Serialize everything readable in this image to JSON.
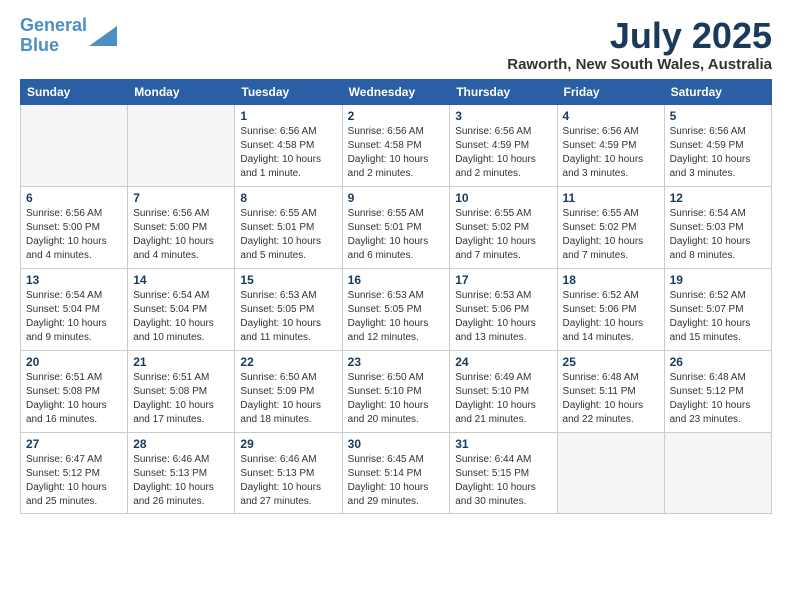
{
  "logo": {
    "line1": "General",
    "line2": "Blue"
  },
  "title": "July 2025",
  "location": "Raworth, New South Wales, Australia",
  "days_of_week": [
    "Sunday",
    "Monday",
    "Tuesday",
    "Wednesday",
    "Thursday",
    "Friday",
    "Saturday"
  ],
  "weeks": [
    [
      {
        "day": "",
        "info": ""
      },
      {
        "day": "",
        "info": ""
      },
      {
        "day": "1",
        "info": "Sunrise: 6:56 AM\nSunset: 4:58 PM\nDaylight: 10 hours and 1 minute."
      },
      {
        "day": "2",
        "info": "Sunrise: 6:56 AM\nSunset: 4:58 PM\nDaylight: 10 hours and 2 minutes."
      },
      {
        "day": "3",
        "info": "Sunrise: 6:56 AM\nSunset: 4:59 PM\nDaylight: 10 hours and 2 minutes."
      },
      {
        "day": "4",
        "info": "Sunrise: 6:56 AM\nSunset: 4:59 PM\nDaylight: 10 hours and 3 minutes."
      },
      {
        "day": "5",
        "info": "Sunrise: 6:56 AM\nSunset: 4:59 PM\nDaylight: 10 hours and 3 minutes."
      }
    ],
    [
      {
        "day": "6",
        "info": "Sunrise: 6:56 AM\nSunset: 5:00 PM\nDaylight: 10 hours and 4 minutes."
      },
      {
        "day": "7",
        "info": "Sunrise: 6:56 AM\nSunset: 5:00 PM\nDaylight: 10 hours and 4 minutes."
      },
      {
        "day": "8",
        "info": "Sunrise: 6:55 AM\nSunset: 5:01 PM\nDaylight: 10 hours and 5 minutes."
      },
      {
        "day": "9",
        "info": "Sunrise: 6:55 AM\nSunset: 5:01 PM\nDaylight: 10 hours and 6 minutes."
      },
      {
        "day": "10",
        "info": "Sunrise: 6:55 AM\nSunset: 5:02 PM\nDaylight: 10 hours and 7 minutes."
      },
      {
        "day": "11",
        "info": "Sunrise: 6:55 AM\nSunset: 5:02 PM\nDaylight: 10 hours and 7 minutes."
      },
      {
        "day": "12",
        "info": "Sunrise: 6:54 AM\nSunset: 5:03 PM\nDaylight: 10 hours and 8 minutes."
      }
    ],
    [
      {
        "day": "13",
        "info": "Sunrise: 6:54 AM\nSunset: 5:04 PM\nDaylight: 10 hours and 9 minutes."
      },
      {
        "day": "14",
        "info": "Sunrise: 6:54 AM\nSunset: 5:04 PM\nDaylight: 10 hours and 10 minutes."
      },
      {
        "day": "15",
        "info": "Sunrise: 6:53 AM\nSunset: 5:05 PM\nDaylight: 10 hours and 11 minutes."
      },
      {
        "day": "16",
        "info": "Sunrise: 6:53 AM\nSunset: 5:05 PM\nDaylight: 10 hours and 12 minutes."
      },
      {
        "day": "17",
        "info": "Sunrise: 6:53 AM\nSunset: 5:06 PM\nDaylight: 10 hours and 13 minutes."
      },
      {
        "day": "18",
        "info": "Sunrise: 6:52 AM\nSunset: 5:06 PM\nDaylight: 10 hours and 14 minutes."
      },
      {
        "day": "19",
        "info": "Sunrise: 6:52 AM\nSunset: 5:07 PM\nDaylight: 10 hours and 15 minutes."
      }
    ],
    [
      {
        "day": "20",
        "info": "Sunrise: 6:51 AM\nSunset: 5:08 PM\nDaylight: 10 hours and 16 minutes."
      },
      {
        "day": "21",
        "info": "Sunrise: 6:51 AM\nSunset: 5:08 PM\nDaylight: 10 hours and 17 minutes."
      },
      {
        "day": "22",
        "info": "Sunrise: 6:50 AM\nSunset: 5:09 PM\nDaylight: 10 hours and 18 minutes."
      },
      {
        "day": "23",
        "info": "Sunrise: 6:50 AM\nSunset: 5:10 PM\nDaylight: 10 hours and 20 minutes."
      },
      {
        "day": "24",
        "info": "Sunrise: 6:49 AM\nSunset: 5:10 PM\nDaylight: 10 hours and 21 minutes."
      },
      {
        "day": "25",
        "info": "Sunrise: 6:48 AM\nSunset: 5:11 PM\nDaylight: 10 hours and 22 minutes."
      },
      {
        "day": "26",
        "info": "Sunrise: 6:48 AM\nSunset: 5:12 PM\nDaylight: 10 hours and 23 minutes."
      }
    ],
    [
      {
        "day": "27",
        "info": "Sunrise: 6:47 AM\nSunset: 5:12 PM\nDaylight: 10 hours and 25 minutes."
      },
      {
        "day": "28",
        "info": "Sunrise: 6:46 AM\nSunset: 5:13 PM\nDaylight: 10 hours and 26 minutes."
      },
      {
        "day": "29",
        "info": "Sunrise: 6:46 AM\nSunset: 5:13 PM\nDaylight: 10 hours and 27 minutes."
      },
      {
        "day": "30",
        "info": "Sunrise: 6:45 AM\nSunset: 5:14 PM\nDaylight: 10 hours and 29 minutes."
      },
      {
        "day": "31",
        "info": "Sunrise: 6:44 AM\nSunset: 5:15 PM\nDaylight: 10 hours and 30 minutes."
      },
      {
        "day": "",
        "info": ""
      },
      {
        "day": "",
        "info": ""
      }
    ]
  ]
}
